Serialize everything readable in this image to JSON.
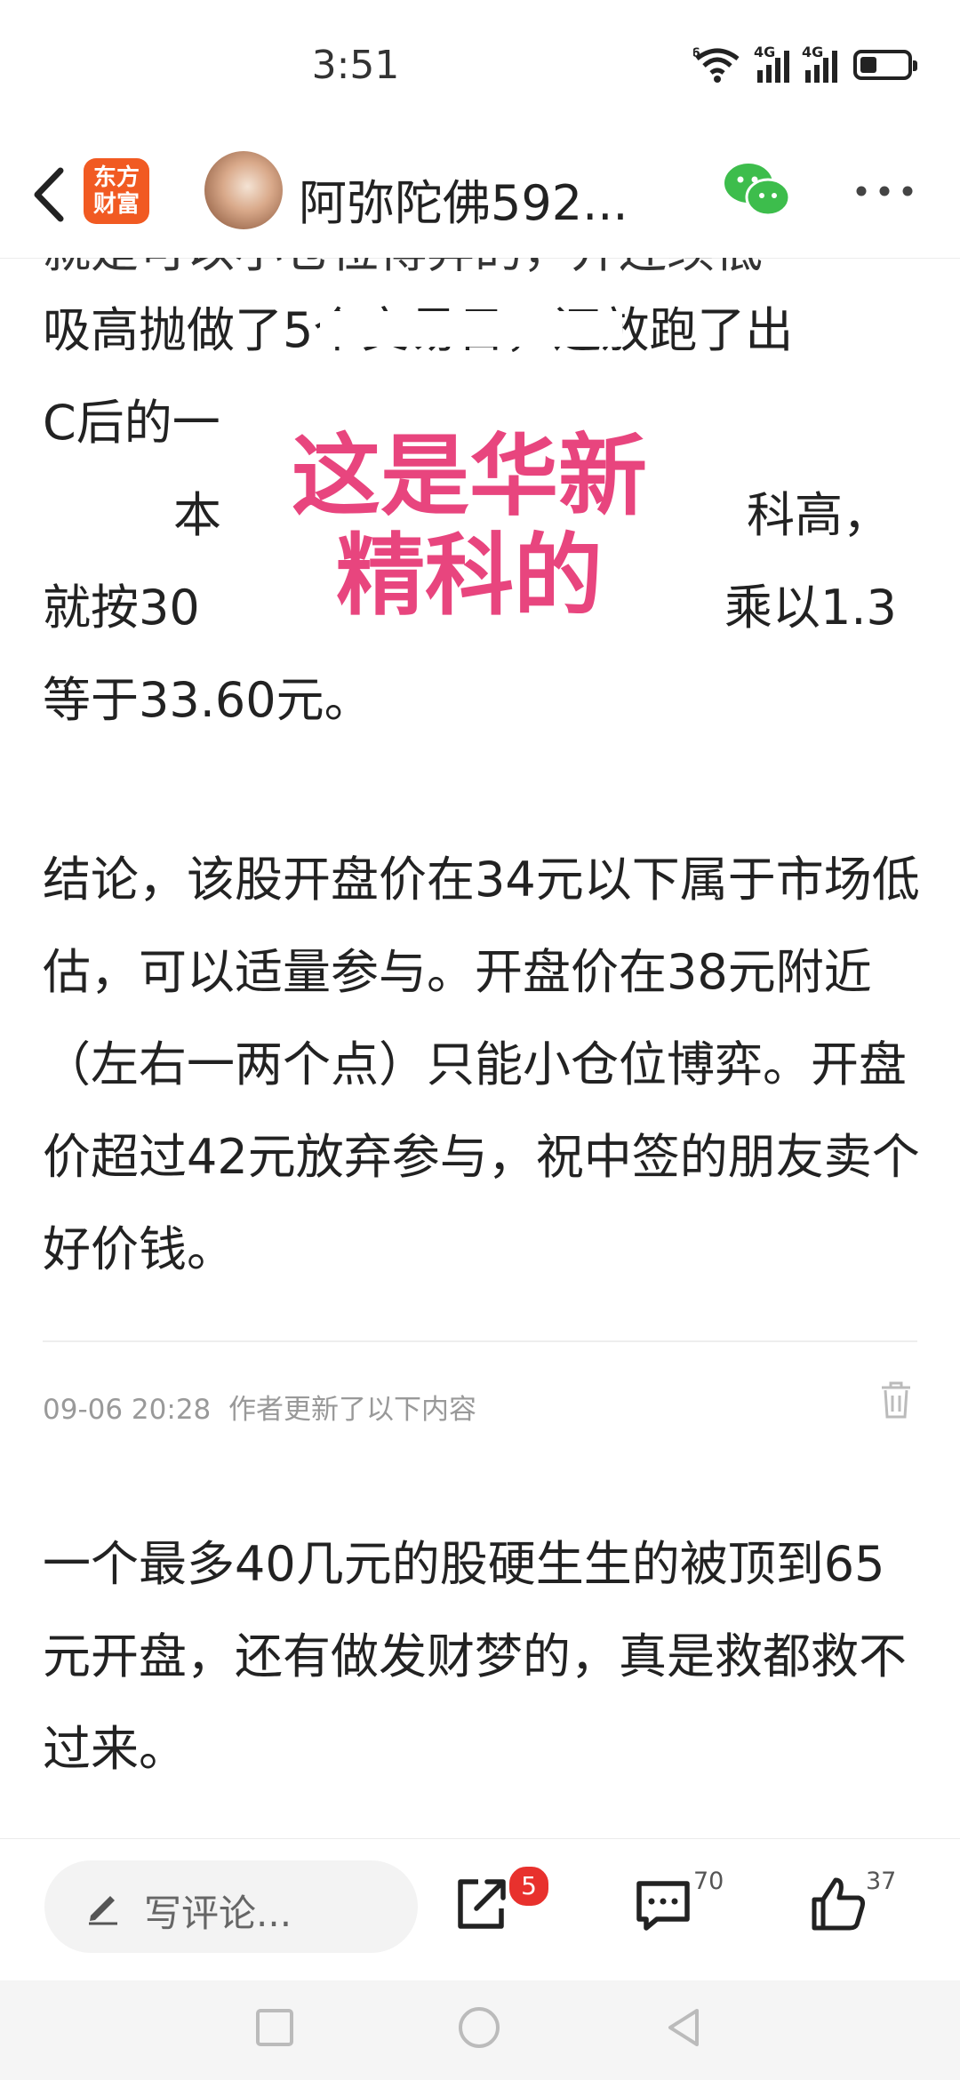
{
  "status_bar": {
    "time": "3:51",
    "net1": "6",
    "net2": "4G",
    "net3": "4G",
    "battery_level": 0.35
  },
  "header": {
    "app_logo_line1": "东方",
    "app_logo_line2": "财富",
    "author_name": "阿弥陀佛592..."
  },
  "article": {
    "p1_line1": "吸高抛做了5个交易日，还放跑了出",
    "p1_line2": "C后的一",
    "p1_line3": "本",
    "p1_line3_right": "科高，",
    "p1_line4": "就按30",
    "p1_line4_right": "乘以1.3",
    "p1_line5": "等于33.60元。",
    "overlay_text": "这是华新精科的",
    "conclusion": "结论，该股开盘价在34元以下属于市场低估，可以适量参与。开盘价在38元附近（左右一两个点）只能小仓位博弈。开盘价超过42元放弃参与，祝中签的朋友卖个好价钱。",
    "update_time": "09-06 20:28",
    "update_note": "作者更新了以下内容",
    "update_text": "一个最多40几元的股硬生生的被顶到65元开盘，还有做发财梦的，真是救都救不过来。"
  },
  "actions": {
    "comment_placeholder": "写评论...",
    "share_badge": "5",
    "comment_count": "70",
    "like_count": "37"
  }
}
